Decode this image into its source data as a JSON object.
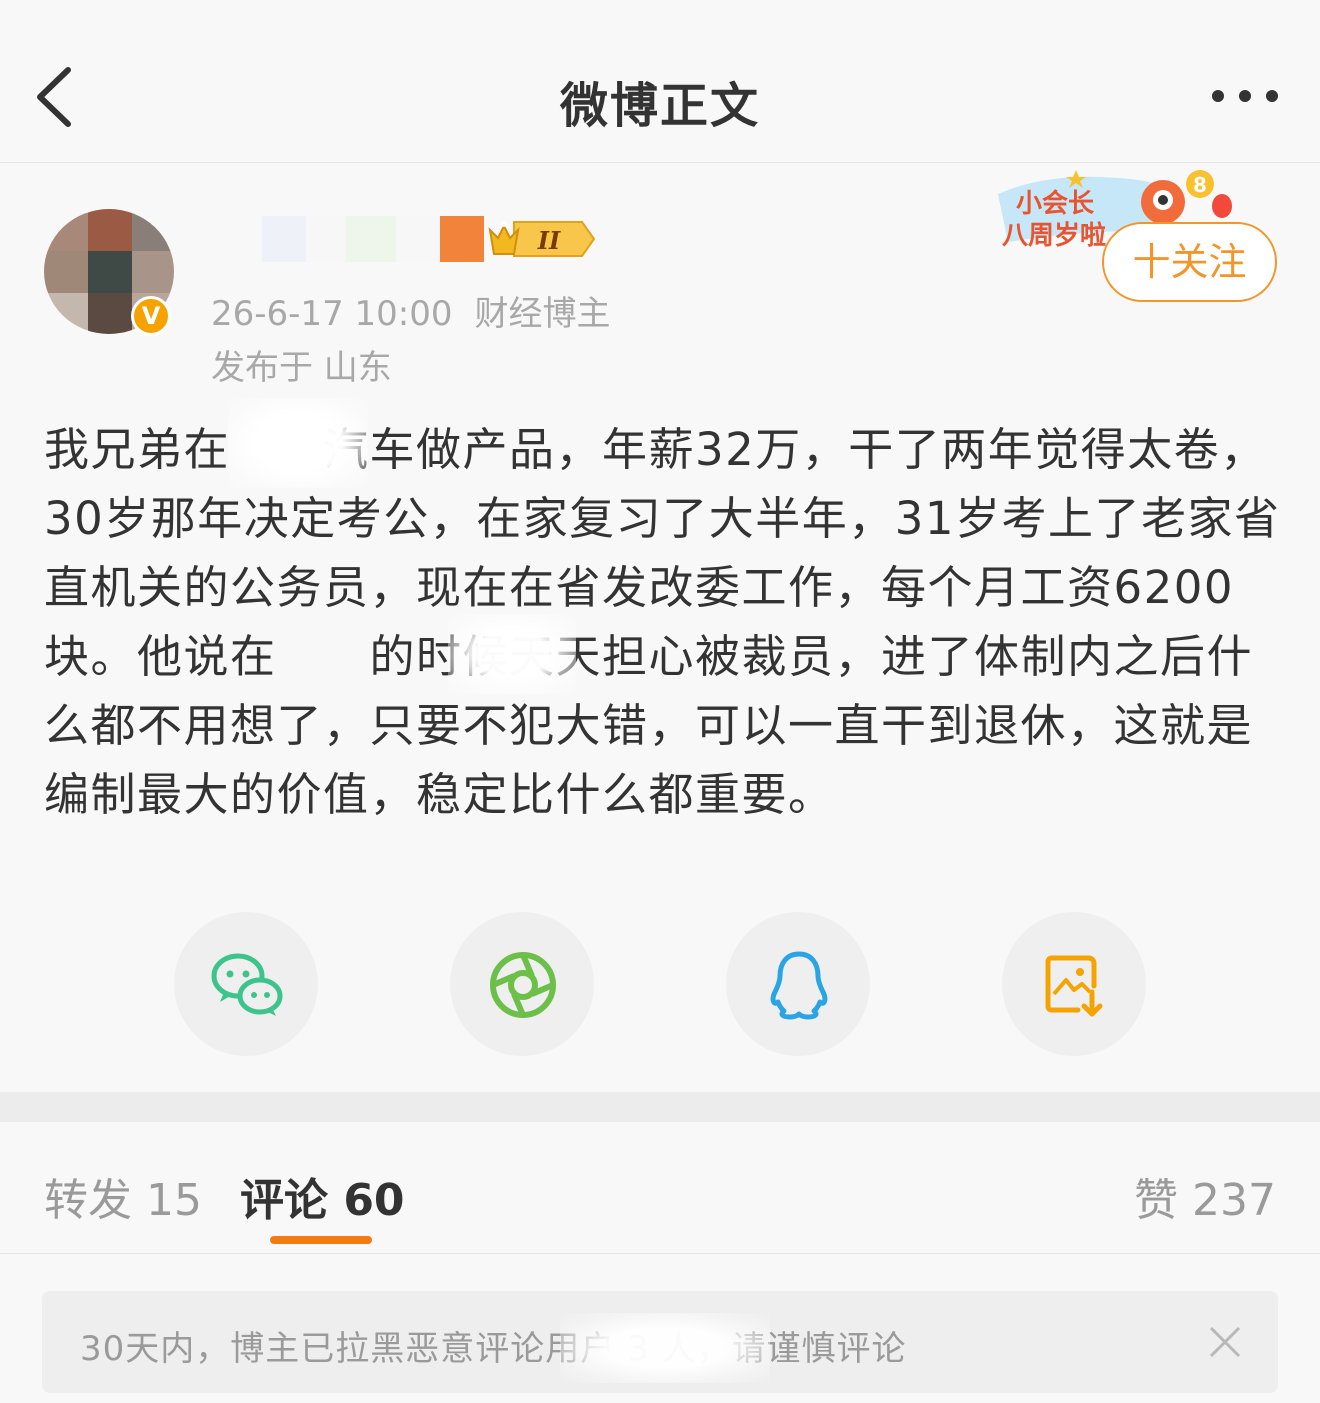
{
  "nav": {
    "title": "微博正文",
    "back_icon": "chevron-left-icon",
    "more_icon": "more-dots-icon"
  },
  "author": {
    "badge": "V",
    "level_badge": "II",
    "time": "26-6-17 10:00",
    "category": "财经博主",
    "location": "发布于 山东"
  },
  "anniversary": {
    "line1": "小会长",
    "line2": "八周岁啦",
    "number": "8"
  },
  "follow": {
    "label": "十关注"
  },
  "post": {
    "text": "我兄弟在　　汽车做产品，年薪32万，干了两年觉得太卷，30岁那年决定考公，在家复习了大半年，31岁考上了老家省直机关的公务员，现在在省发改委工作，每个月工资6200块。他说在　　的时候天天担心被裁员，进了体制内之后什么都不用想了，只要不犯大错，可以一直干到退休，这就是编制最大的价值，稳定比什么都重要。"
  },
  "share": {
    "wechat_icon": "wechat-icon",
    "moments_icon": "moments-icon",
    "qq_icon": "qq-icon",
    "save_image_icon": "save-image-icon"
  },
  "tabs": {
    "repost": "转发 15",
    "comment": "评论 60",
    "like": "赞 237"
  },
  "notice": {
    "text": "30天内，博主已拉黑恶意评论用户 3 人，请谨慎评论",
    "close_icon": "close-icon"
  },
  "colors": {
    "accent": "#f27b12",
    "follow": "#f2962c",
    "wechat": "#3cc48c",
    "moments": "#6cc04a",
    "qq": "#2aa4e4",
    "save": "#f5a300"
  }
}
